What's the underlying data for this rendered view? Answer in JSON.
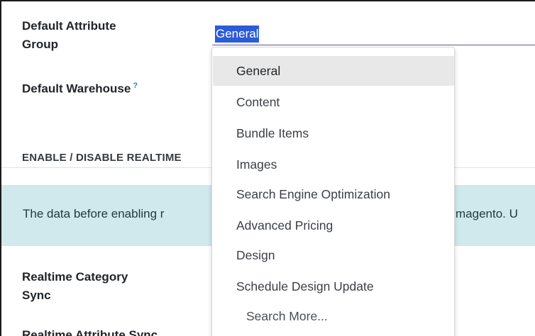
{
  "form": {
    "default_attribute_group_label": "Default Attribute\nGroup",
    "default_attribute_group_line1": "Default Attribute",
    "default_attribute_group_line2": "Group",
    "default_attribute_group_value": "General",
    "default_warehouse_label": "Default Warehouse",
    "help_mark": "?"
  },
  "section": {
    "title": "ENABLE / DISABLE REALTIME"
  },
  "alert": {
    "text_left": "The data before enabling r",
    "text_right": "magento. U"
  },
  "realtime": {
    "category_sync_line1": "Realtime Category",
    "category_sync_line2": "Sync",
    "attribute_sync": "Realtime Attribute Sync"
  },
  "dropdown": {
    "items": [
      {
        "label": "General",
        "active": true
      },
      {
        "label": "Content"
      },
      {
        "label": "Bundle Items"
      },
      {
        "label": "Images"
      },
      {
        "label": "Search Engine Optimization"
      },
      {
        "label": "Advanced Pricing"
      },
      {
        "label": "Design"
      },
      {
        "label": "Schedule Design Update"
      }
    ],
    "search_more": "Search More..."
  },
  "colors": {
    "selection_bg": "#2b5bd7",
    "alert_bg": "#cfe9ec",
    "active_item_bg": "#e8e8e8",
    "help_color": "#2a7fb8"
  }
}
